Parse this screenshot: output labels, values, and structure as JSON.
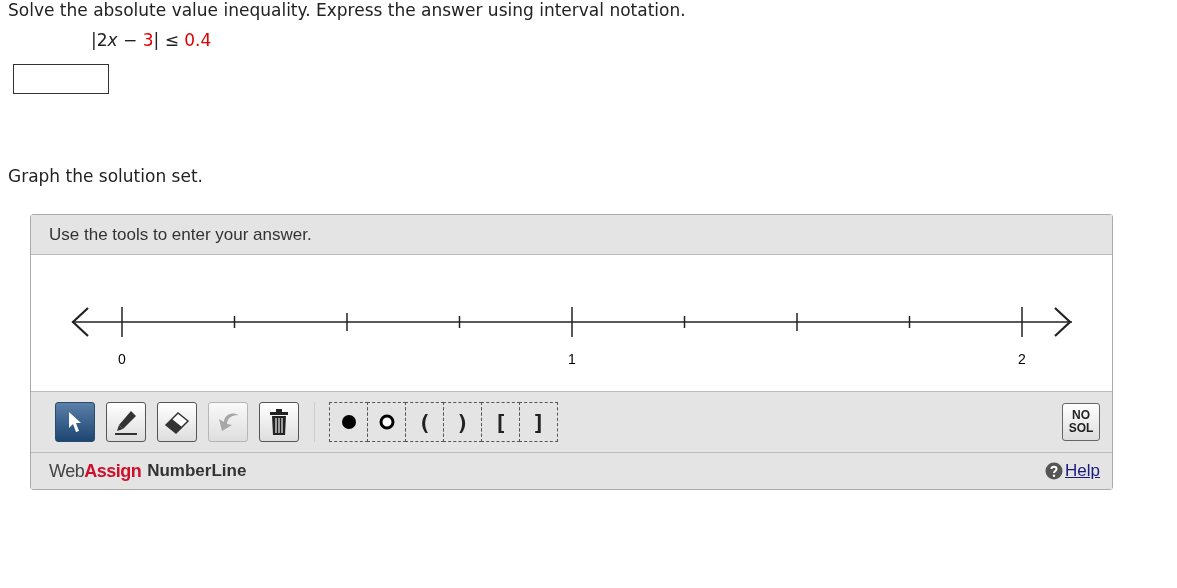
{
  "instruction": "Solve the absolute value inequality. Express the answer using interval notation.",
  "inequality": [
    {
      "kind": "text",
      "text": "|2",
      "highlight": false
    },
    {
      "kind": "variable",
      "text": "x",
      "highlight": false
    },
    {
      "kind": "text",
      "text": " − ",
      "highlight": false
    },
    {
      "kind": "text",
      "text": "3",
      "highlight": true
    },
    {
      "kind": "text",
      "text": "| ≤ ",
      "highlight": false
    },
    {
      "kind": "text",
      "text": "0.4",
      "highlight": true
    }
  ],
  "graph_prompt": "Graph the solution set.",
  "numberline": {
    "header": "Use the tools to enter your answer.",
    "labels": [
      "0",
      "1",
      "2"
    ],
    "tools": [
      {
        "kind": "select",
        "selected": true,
        "disabled": false
      },
      {
        "kind": "pencil",
        "selected": false,
        "disabled": false
      },
      {
        "kind": "eraser",
        "selected": false,
        "disabled": false
      },
      {
        "kind": "undo",
        "selected": false,
        "disabled": true
      },
      {
        "kind": "trash",
        "selected": false,
        "disabled": false
      }
    ],
    "points": [
      {
        "kind": "closed-dot"
      },
      {
        "kind": "open-dot"
      },
      {
        "kind": "char",
        "text": "("
      },
      {
        "kind": "char",
        "text": ")"
      },
      {
        "kind": "char",
        "text": "["
      },
      {
        "kind": "char",
        "text": "]"
      }
    ],
    "no_solution": "NO SOL",
    "brand_web": "Web",
    "brand_assign": "Assign",
    "brand_product": "NumberLine",
    "help": "Help"
  }
}
